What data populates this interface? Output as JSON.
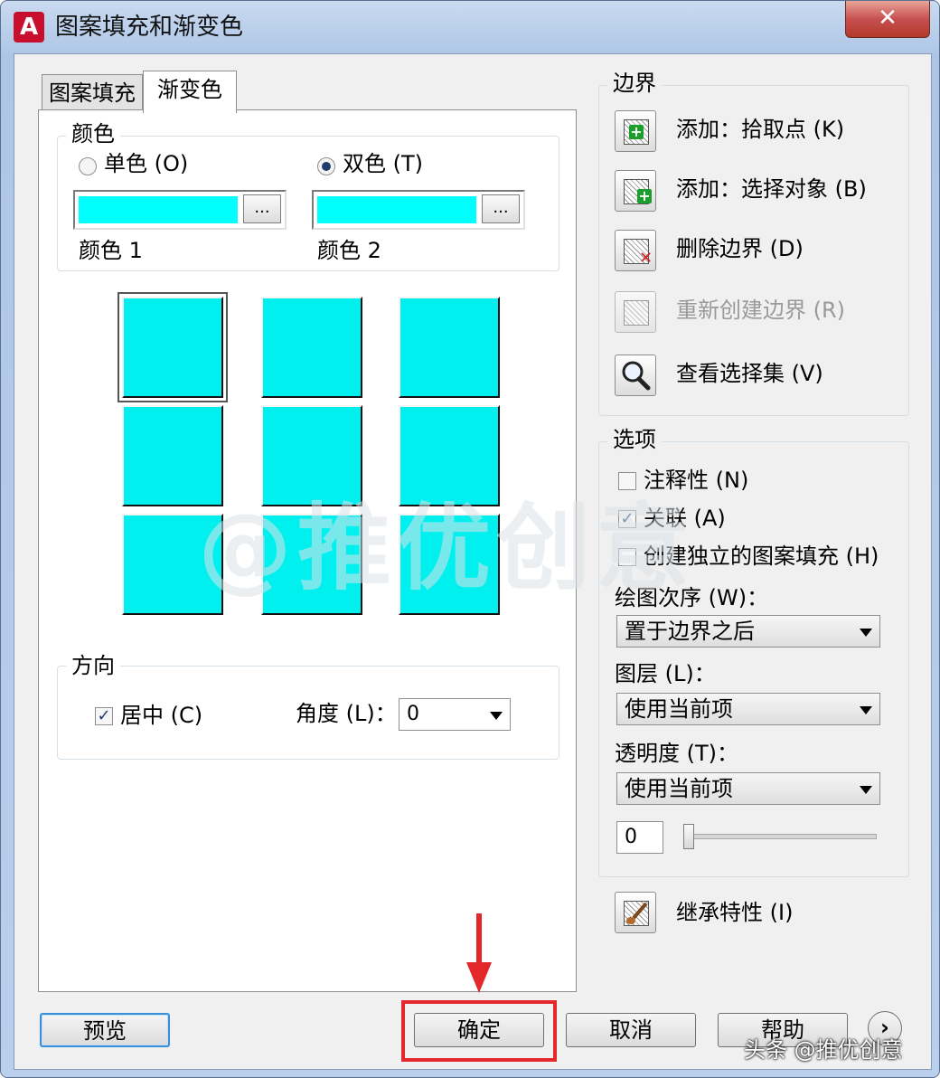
{
  "window": {
    "title": "图案填充和渐变色",
    "close_label": "✕"
  },
  "tabs": [
    {
      "label": "图案填充"
    },
    {
      "label": "渐变色"
    }
  ],
  "color_group": {
    "title": "颜色",
    "single_label": "单色 (O)",
    "dual_label": "双色 (T)",
    "selected_mode": "双色",
    "color1_label": "颜色 1",
    "color2_label": "颜色 2",
    "browse_label": "...",
    "swatch_color": "#00ffff"
  },
  "gradient_grid": {
    "count": 9,
    "selected_index": 0
  },
  "direction_group": {
    "title": "方向",
    "center_label": "居中 (C)",
    "center_checked": true,
    "angle_label": "角度 (L)：",
    "angle_value": "0"
  },
  "boundary_group": {
    "title": "边界",
    "items": [
      {
        "label": "添加：拾取点 (K)",
        "icon": "pick-points-icon",
        "enabled": true
      },
      {
        "label": "添加：选择对象 (B)",
        "icon": "select-objects-icon",
        "enabled": true
      },
      {
        "label": "删除边界 (D)",
        "icon": "remove-boundary-icon",
        "enabled": true
      },
      {
        "label": "重新创建边界 (R)",
        "icon": "recreate-boundary-icon",
        "enabled": false
      },
      {
        "label": "查看选择集 (V)",
        "icon": "magnifier-icon",
        "enabled": true
      }
    ]
  },
  "options_group": {
    "title": "选项",
    "annotative_label": "注释性 (N)",
    "annotative_checked": false,
    "associative_label": "关联 (A)",
    "associative_checked": true,
    "separate_label": "创建独立的图案填充 (H)",
    "separate_checked": false,
    "draw_order_label": "绘图次序 (W)：",
    "draw_order_value": "置于边界之后",
    "layer_label": "图层 (L)：",
    "layer_value": "使用当前项",
    "transparency_label": "透明度 (T)：",
    "transparency_value": "使用当前项",
    "transparency_number": "0",
    "transparency_level": 0
  },
  "inherit_label": "继承特性 (I)",
  "buttons": {
    "preview": "预览",
    "ok": "确定",
    "cancel": "取消",
    "help": "帮助",
    "more": "›"
  },
  "watermark": "@推优创意",
  "footer_watermark": "头条 @推优创意",
  "colors": {
    "cyan": "#00ffff",
    "annotation_red": "#e3282c"
  }
}
